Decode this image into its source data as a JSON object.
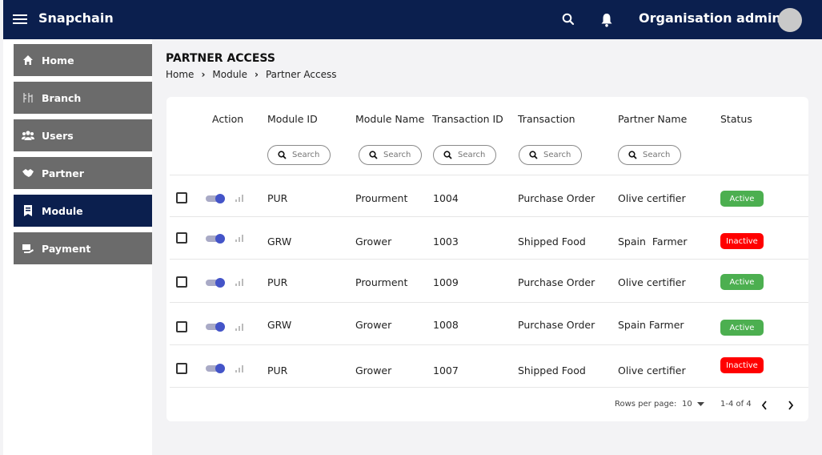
{
  "app": {
    "title": "Snapchain",
    "role": "Organisation admin"
  },
  "sidebar": {
    "items": [
      {
        "label": "Home",
        "icon": "home-icon",
        "active": false
      },
      {
        "label": "Branch",
        "icon": "branch-icon",
        "active": false
      },
      {
        "label": "Users",
        "icon": "users-icon",
        "active": false
      },
      {
        "label": "Partner",
        "icon": "handshake-icon",
        "active": false
      },
      {
        "label": "Module",
        "icon": "module-icon",
        "active": true
      },
      {
        "label": "Payment",
        "icon": "payment-icon",
        "active": false
      }
    ]
  },
  "page": {
    "title": "PARTNER ACCESS",
    "breadcrumb": [
      "Home",
      "Module",
      "Partner Access"
    ]
  },
  "table": {
    "columns": {
      "action": "Action",
      "module_id": "Module ID",
      "module_name": "Module Name",
      "transaction_id": "Transaction ID",
      "transaction": "Transaction",
      "partner_name": "Partner Name",
      "status": "Status"
    },
    "search_placeholder": "Search",
    "rows": [
      {
        "module_id": "PUR",
        "module_name": "Prourment",
        "transaction_id": "1004",
        "transaction": "Purchase Order",
        "partner_name": "Olive certifier",
        "status": "Active"
      },
      {
        "module_id": "GRW",
        "module_name": "Grower",
        "transaction_id": "1003",
        "transaction": "Shipped Food",
        "partner_name": "Spain  Farmer",
        "status": "Inactive"
      },
      {
        "module_id": "PUR",
        "module_name": "Prourment",
        "transaction_id": "1009",
        "transaction": "Purchase Order",
        "partner_name": "Olive certifier",
        "status": "Active"
      },
      {
        "module_id": "GRW",
        "module_name": "Grower",
        "transaction_id": "1008",
        "transaction": "Purchase Order",
        "partner_name": "Spain Farmer",
        "status": "Active"
      },
      {
        "module_id": "PUR",
        "module_name": "Grower",
        "transaction_id": "1007",
        "transaction": "Shipped Food",
        "partner_name": "Olive certifier",
        "status": "Inactive"
      }
    ]
  },
  "pagination": {
    "rows_per_page_label": "Rows per page:",
    "rows_per_page": "10",
    "range": "1-4 of 4"
  },
  "colors": {
    "navy": "#0b1f4e",
    "sidebar_gray": "#6b6b6b",
    "active": "#4caf50",
    "inactive": "#ff0000"
  }
}
